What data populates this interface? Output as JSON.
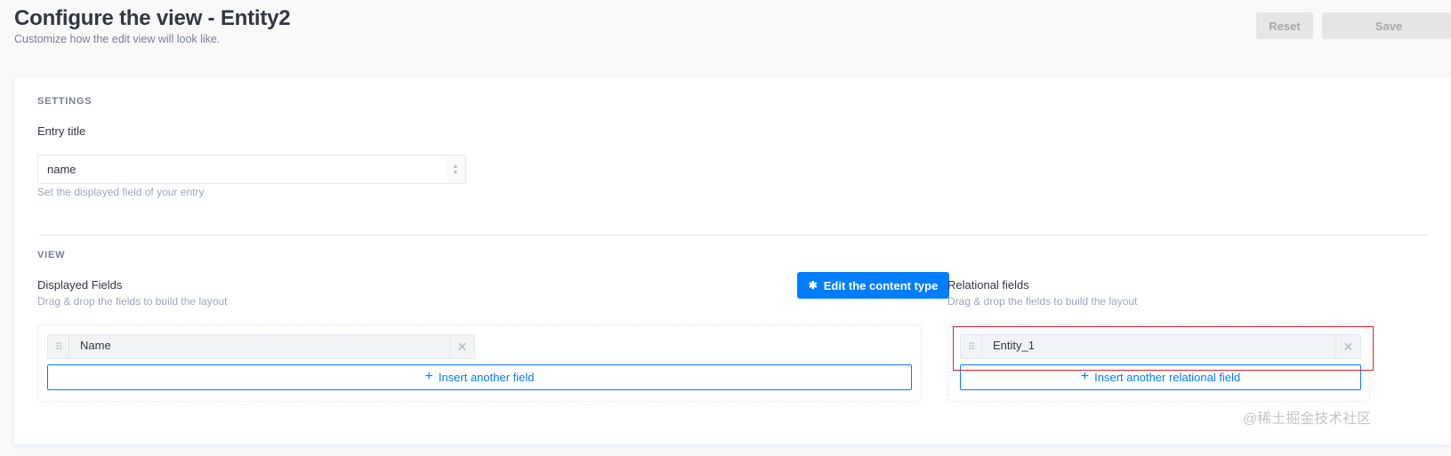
{
  "header": {
    "title": "Configure the view - Entity2",
    "subtitle": "Customize how the edit view will look like.",
    "reset_label": "Reset",
    "save_label": "Save"
  },
  "settings": {
    "section_label": "SETTINGS",
    "entry_title_label": "Entry title",
    "entry_title_value": "name",
    "entry_title_hint": "Set the displayed field of your entry"
  },
  "view": {
    "section_label": "VIEW",
    "displayed_fields": {
      "label": "Displayed Fields",
      "hint": "Drag & drop the fields to build the layout",
      "edit_button_label": "Edit the content type",
      "fields": [
        "Name"
      ],
      "insert_label": "Insert another field"
    },
    "relational_fields": {
      "label": "Relational fields",
      "hint": "Drag & drop the fields to build the layout",
      "fields": [
        "Entity_1"
      ],
      "insert_label": "Insert another relational field"
    }
  },
  "watermark": "@稀土掘金技术社区",
  "colors": {
    "primary": "#007eff",
    "highlight": "#d9262c"
  }
}
